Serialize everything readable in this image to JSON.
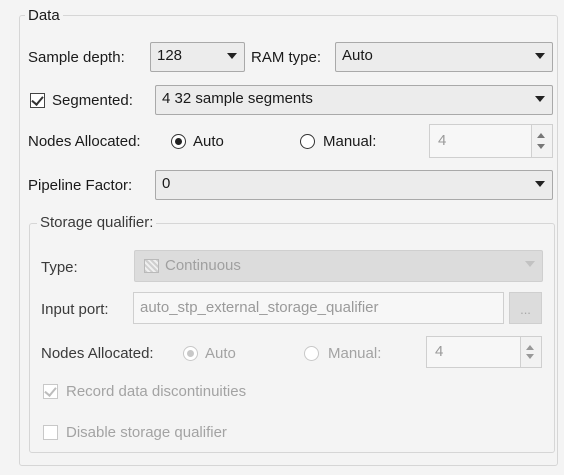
{
  "data_group": {
    "title": "Data",
    "sample_depth_label": "Sample depth:",
    "sample_depth_value": "128",
    "ram_type_label": "RAM type:",
    "ram_type_value": "Auto",
    "segmented_label": "Segmented:",
    "segmented_checked": true,
    "segmented_value": "4 32 sample segments",
    "nodes_label": "Nodes Allocated:",
    "nodes_auto_label": "Auto",
    "nodes_manual_label": "Manual:",
    "nodes_selected": "Auto",
    "nodes_manual_value": "4",
    "pipeline_label": "Pipeline Factor:",
    "pipeline_value": "0"
  },
  "storage_group": {
    "title": "Storage qualifier:",
    "type_label": "Type:",
    "type_icon": "continuous-pattern-icon",
    "type_value": "Continuous",
    "input_port_label": "Input port:",
    "input_port_value": "auto_stp_external_storage_qualifier",
    "browse_label": "...",
    "nodes_label": "Nodes Allocated:",
    "nodes_auto_label": "Auto",
    "nodes_manual_label": "Manual:",
    "nodes_selected": "Auto",
    "nodes_manual_value": "4",
    "record_label": "Record data discontinuities",
    "record_checked": true,
    "disable_label": "Disable storage qualifier",
    "disable_checked": false
  }
}
